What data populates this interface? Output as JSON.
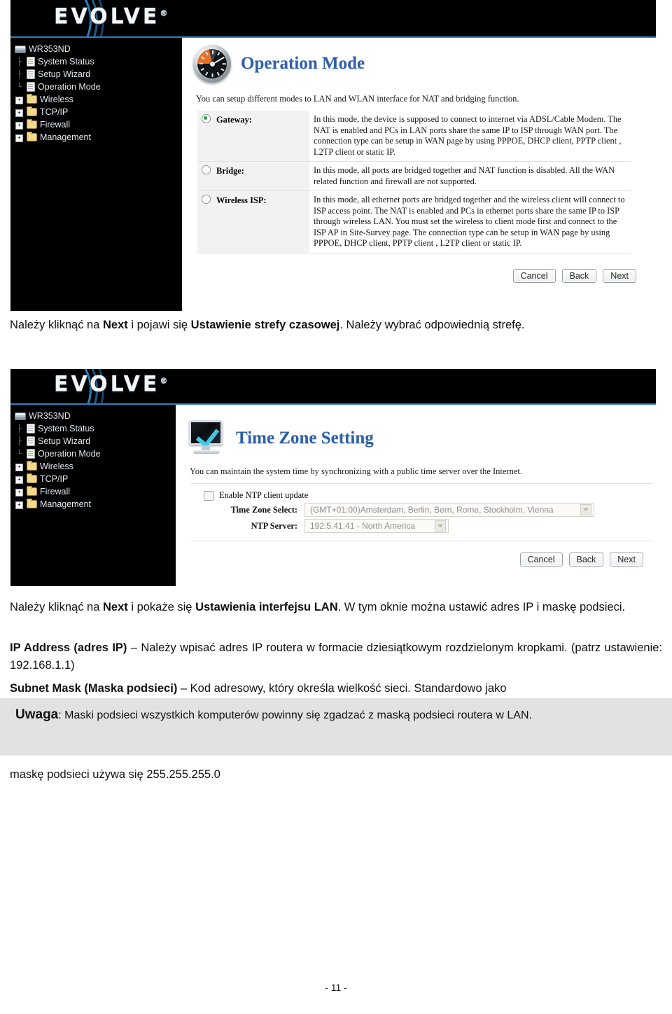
{
  "document": {
    "page_number": "- 11 -",
    "paragraphs": [
      {
        "id": "p1",
        "runs": [
          {
            "t": "Należy kliknąć na ",
            "b": false
          },
          {
            "t": "Next",
            "b": true
          },
          {
            "t": " i pojawi się ",
            "b": false
          },
          {
            "t": "Ustawienie strefy czasowej",
            "b": true
          },
          {
            "t": ". Należy wybrać odpowiednią strefę.",
            "b": false
          }
        ]
      },
      {
        "id": "p2",
        "runs": [
          {
            "t": "Należy kliknąć na ",
            "b": false
          },
          {
            "t": "Next",
            "b": true
          },
          {
            "t": " i pokaże się ",
            "b": false
          },
          {
            "t": "Ustawienia interfejsu LAN",
            "b": true
          },
          {
            "t": ". W tym oknie można ustawić adres IP i maskę podsieci.",
            "b": false
          }
        ]
      },
      {
        "id": "p3",
        "runs": [
          {
            "t": "IP Address (adres IP)",
            "b": true
          },
          {
            "t": " – Należy wpisać adres IP routera w formacie dziesiątkowym rozdzielonym kropkami.  (patrz ustawienie: 192.168.1.1)",
            "b": false
          }
        ]
      },
      {
        "id": "p4",
        "runs": [
          {
            "t": "Subnet Mask (Maska podsieci)",
            "b": true
          },
          {
            "t": " – Kod adresowy, który określa wielkość sieci. Standardowo jako",
            "b": false
          }
        ]
      },
      {
        "id": "p5",
        "runs": [
          {
            "t": "maskę podsieci używa się 255.255.255.0",
            "b": false
          }
        ]
      }
    ],
    "note": {
      "label": "Uwaga",
      "separator": ": ",
      "text": "Maski podsieci wszystkich komputerów powinny się zgadzać z maską podsieci routera w LAN.",
      "background": "#e2e2e2"
    }
  },
  "screenshots": [
    {
      "id": "operation-mode",
      "brand": "EVOLVE",
      "brand_mark": "®",
      "sidebar": {
        "root": {
          "label": "WR353ND",
          "icon": "router-icon"
        },
        "items": [
          {
            "label": "System Status",
            "icon": "page-icon",
            "expandable": false
          },
          {
            "label": "Setup Wizard",
            "icon": "page-icon",
            "expandable": false
          },
          {
            "label": "Operation Mode",
            "icon": "page-icon",
            "expandable": false
          },
          {
            "label": "Wireless",
            "icon": "folder-icon",
            "expandable": true,
            "expander": "+"
          },
          {
            "label": "TCP/IP",
            "icon": "folder-icon",
            "expandable": true,
            "expander": "+"
          },
          {
            "label": "Firewall",
            "icon": "folder-icon",
            "expandable": true,
            "expander": "+"
          },
          {
            "label": "Management",
            "icon": "folder-icon",
            "expandable": true,
            "expander": "+"
          }
        ]
      },
      "page": {
        "title": "Operation Mode",
        "icon": "clock-icon",
        "intro": "You can setup different modes to LAN and WLAN interface for NAT and bridging function.",
        "modes": [
          {
            "label": "Gateway:",
            "selected": true,
            "description": "In this mode, the device is supposed to connect to internet via ADSL/Cable Modem. The NAT is enabled and PCs in LAN ports share the same IP to ISP through WAN port. The connection type can be setup in WAN page by using PPPOE, DHCP client, PPTP client , L2TP client or static IP."
          },
          {
            "label": "Bridge:",
            "selected": false,
            "description": "In this mode, all ports are bridged together and NAT function is disabled. All the WAN related function and firewall are not supported."
          },
          {
            "label": "Wireless ISP:",
            "selected": false,
            "description": "In this mode, all ethernet ports are bridged together and the wireless client will connect to ISP access point. The NAT is enabled and PCs in ethernet ports share the same IP to ISP through wireless LAN. You must set the wireless to client mode first and connect to the ISP AP in Site-Survey page. The connection type can be setup in WAN page by using PPPOE, DHCP client, PPTP client , L2TP client or static IP."
          }
        ],
        "buttons": [
          {
            "label": "Cancel",
            "name": "cancel-button"
          },
          {
            "label": "Back",
            "name": "back-button"
          },
          {
            "label": "Next",
            "name": "next-button"
          }
        ]
      }
    },
    {
      "id": "time-zone-setting",
      "brand": "EVOLVE",
      "brand_mark": "®",
      "sidebar": {
        "root": {
          "label": "WR353ND",
          "icon": "router-icon"
        },
        "items": [
          {
            "label": "System Status",
            "icon": "page-icon",
            "expandable": false
          },
          {
            "label": "Setup Wizard",
            "icon": "page-icon",
            "expandable": false
          },
          {
            "label": "Operation Mode",
            "icon": "page-icon",
            "expandable": false
          },
          {
            "label": "Wireless",
            "icon": "folder-icon",
            "expandable": true,
            "expander": "+"
          },
          {
            "label": "TCP/IP",
            "icon": "folder-icon",
            "expandable": true,
            "expander": "+"
          },
          {
            "label": "Firewall",
            "icon": "folder-icon",
            "expandable": true,
            "expander": "+"
          },
          {
            "label": "Management",
            "icon": "folder-icon",
            "expandable": true,
            "expander": "+"
          }
        ]
      },
      "page": {
        "title": "Time Zone Setting",
        "icon": "monitor-check-icon",
        "intro": "You can maintain the system time by synchronizing with a public time server over the Internet.",
        "form": {
          "ntp_checkbox_label": "Enable NTP client update",
          "ntp_checkbox_checked": false,
          "timezone_label": "Time Zone Select:",
          "timezone_value": "(GMT+01:00)Amsterdam, Berlin, Bern, Rome, Stockholm, Vienna",
          "ntp_server_label": "NTP Server:",
          "ntp_server_value": "192.5.41.41 - North America"
        },
        "buttons": [
          {
            "label": "Cancel",
            "name": "cancel-button"
          },
          {
            "label": "Back",
            "name": "back-button"
          },
          {
            "label": "Next",
            "name": "next-button"
          }
        ]
      }
    }
  ],
  "colors": {
    "title_blue": "#2f5fa8",
    "banner_black": "#000000",
    "banner_underline": "#2f7fbf",
    "note_bg": "#e2e2e2",
    "radio_on": "#2f9b3f",
    "clock_orange": "#e8722a",
    "check_cyan": "#3fc7e8"
  }
}
